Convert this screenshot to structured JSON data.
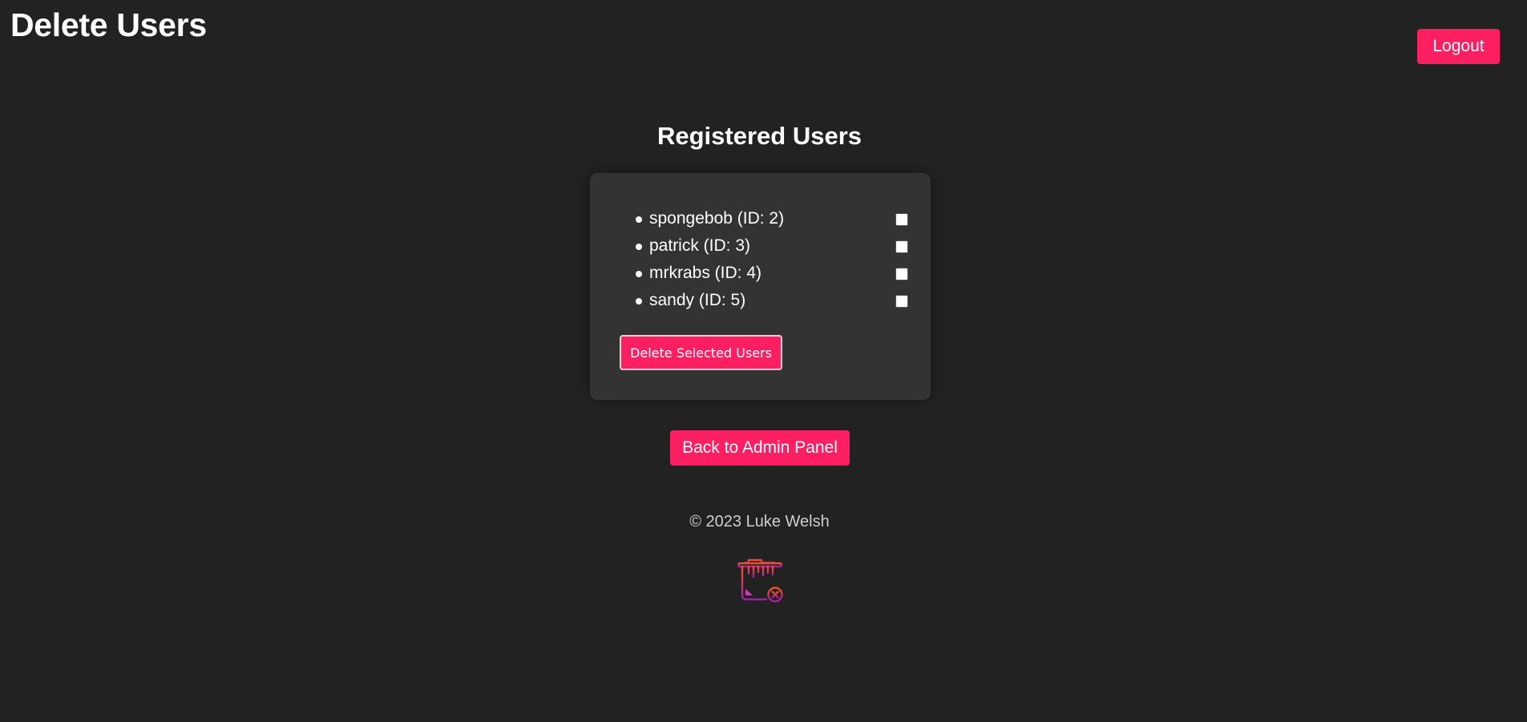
{
  "header": {
    "title": "Delete Users",
    "logout_label": "Logout"
  },
  "main": {
    "section_title": "Registered Users",
    "users": [
      {
        "label": "spongebob (ID: 2)",
        "checked": false
      },
      {
        "label": "patrick (ID: 3)",
        "checked": false
      },
      {
        "label": "mrkrabs (ID: 4)",
        "checked": false
      },
      {
        "label": "sandy (ID: 5)",
        "checked": false
      }
    ],
    "delete_button_label": "Delete Selected Users",
    "back_button_label": "Back to Admin Panel"
  },
  "footer": {
    "copyright": "© 2023 Luke Welsh",
    "icon": "trash-bin-remove-icon"
  },
  "colors": {
    "background": "#222222",
    "card": "#333333",
    "accent": "#fe1f63",
    "icon_gradient_top": "#f2521c",
    "icon_gradient_bottom": "#a21ca8"
  }
}
